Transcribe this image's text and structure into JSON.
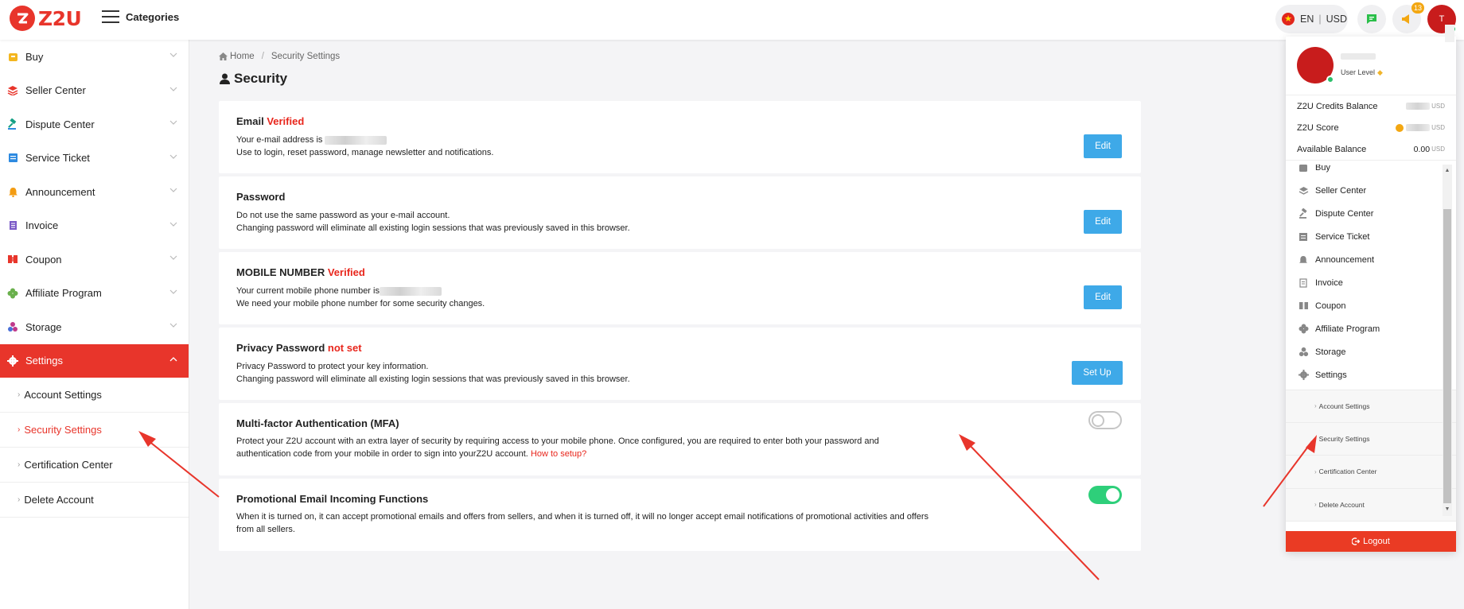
{
  "header": {
    "logo_icon": "z2u-logo-icon",
    "logo_text": "Z2U",
    "categories_label": "Categories",
    "language": "EN",
    "currency": "USD",
    "notification_count": "13",
    "avatar_initial": "T"
  },
  "sidebar": {
    "items": [
      {
        "label": "Buy",
        "icon": "cart-icon",
        "color": "#f3b61f"
      },
      {
        "label": "Seller Center",
        "icon": "layers-icon",
        "color": "#e8352b"
      },
      {
        "label": "Dispute Center",
        "icon": "gavel-icon",
        "color": "#16a085"
      },
      {
        "label": "Service Ticket",
        "icon": "ticket-icon",
        "color": "#2d8ae0"
      },
      {
        "label": "Announcement",
        "icon": "bell-icon",
        "color": "#f39c12"
      },
      {
        "label": "Invoice",
        "icon": "invoice-icon",
        "color": "#7b5bc7"
      },
      {
        "label": "Coupon",
        "icon": "coupon-icon",
        "color": "#e8352b"
      },
      {
        "label": "Affiliate Program",
        "icon": "clover-icon",
        "color": "#6ab04c"
      },
      {
        "label": "Storage",
        "icon": "storage-icon",
        "color": "#c0398b"
      },
      {
        "label": "Settings",
        "icon": "gear-icon",
        "color": "#ffffff"
      }
    ],
    "settings_sub": [
      {
        "label": "Account Settings"
      },
      {
        "label": "Security Settings"
      },
      {
        "label": "Certification Center"
      },
      {
        "label": "Delete Account"
      }
    ]
  },
  "breadcrumb": {
    "home": "Home",
    "current": "Security Settings"
  },
  "page_title": "Security",
  "cards": {
    "email": {
      "title": "Email",
      "status": "Verified",
      "line1": "Your e-mail address is",
      "line2": "Use to login, reset password, manage newsletter and notifications.",
      "button": "Edit"
    },
    "password": {
      "title": "Password",
      "line1": "Do not use the same password as your e-mail account.",
      "line2": "Changing password will eliminate all existing login sessions that was previously saved in this browser.",
      "button": "Edit"
    },
    "mobile": {
      "title": "MOBILE NUMBER",
      "status": "Verified",
      "line1": "Your current mobile phone number is",
      "line2": "We need your mobile phone number for some security changes.",
      "button": "Edit"
    },
    "privacy": {
      "title": "Privacy Password",
      "status": "not set",
      "line1": "Privacy Password to protect your key information.",
      "line2": "Changing password will eliminate all existing login sessions that was previously saved in this browser.",
      "button": "Set Up"
    },
    "mfa": {
      "title": "Multi-factor Authentication (MFA)",
      "desc": "Protect your Z2U account with an extra layer of security by requiring access to your mobile phone. Once configured, you are required to enter both your password and authentication code from your mobile in order to sign into yourZ2U account.",
      "link": "How to setup?",
      "enabled": false
    },
    "promo": {
      "title": "Promotional Email Incoming Functions",
      "desc": "When it is turned on, it can accept promotional emails and offers from sellers, and when it is turned off, it will no longer accept email notifications of promotional activities and offers from all sellers.",
      "enabled": true
    }
  },
  "panel": {
    "user_level": "User Level",
    "balances": [
      {
        "label": "Z2U Credits Balance",
        "unit": "USD"
      },
      {
        "label": "Z2U Score",
        "unit": "USD"
      },
      {
        "label": "Available Balance",
        "value": "0.00",
        "unit": "USD"
      }
    ],
    "menu": [
      "Buy",
      "Seller Center",
      "Dispute Center",
      "Service Ticket",
      "Announcement",
      "Invoice",
      "Coupon",
      "Affiliate Program",
      "Storage",
      "Settings"
    ],
    "settings_sub": [
      "Account Settings",
      "Security Settings",
      "Certification Center",
      "Delete Account"
    ],
    "logout": "Logout"
  },
  "colors": {
    "brand_red": "#e8352b",
    "edit_blue": "#3ea9e8",
    "toggle_green": "#2ecf7a",
    "verified_red": "#e8261c"
  }
}
